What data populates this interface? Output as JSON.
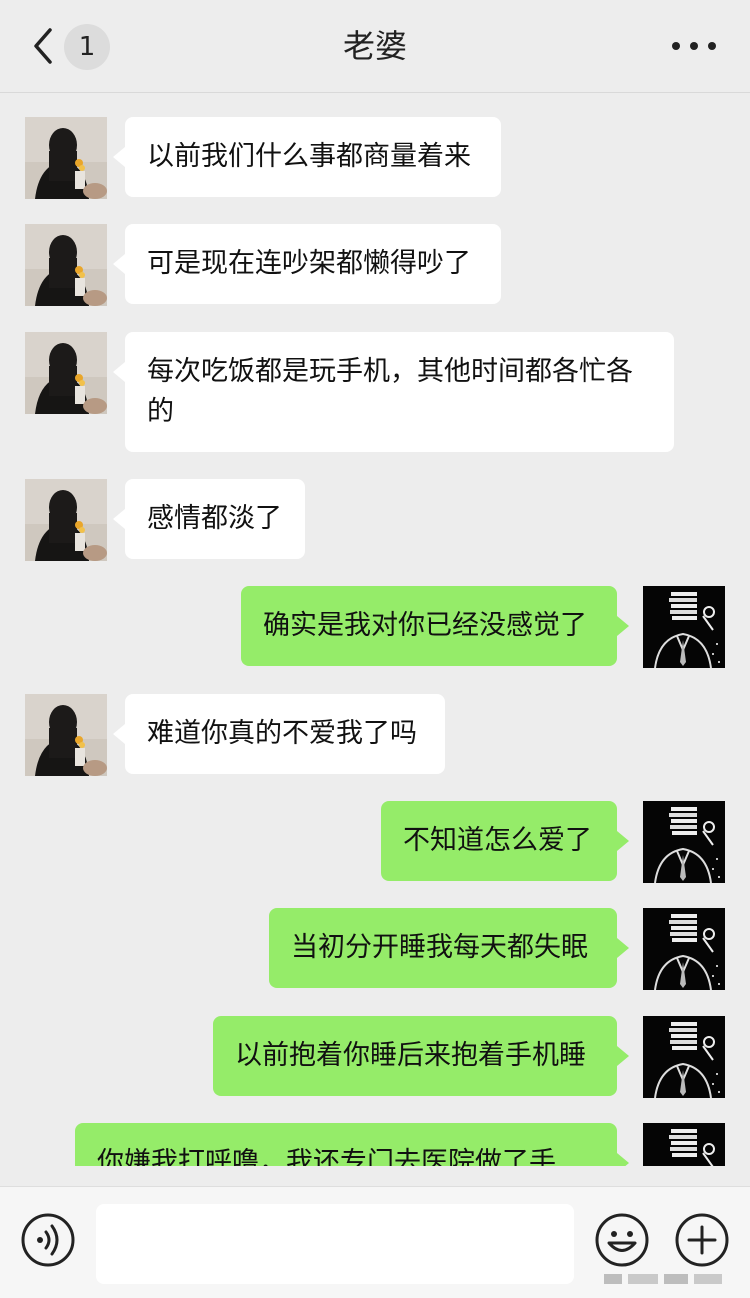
{
  "header": {
    "title": "老婆",
    "unread_count": "1"
  },
  "messages": [
    {
      "side": "in",
      "text": "以前我们什么事都商量着来"
    },
    {
      "side": "in",
      "text": "可是现在连吵架都懒得吵了"
    },
    {
      "side": "in",
      "text": "每次吃饭都是玩手机，其他时间都各忙各的"
    },
    {
      "side": "in",
      "text": "感情都淡了"
    },
    {
      "side": "out",
      "text": "确实是我对你已经没感觉了"
    },
    {
      "side": "in",
      "text": "难道你真的不爱我了吗"
    },
    {
      "side": "out",
      "text": "不知道怎么爱了"
    },
    {
      "side": "out",
      "text": "当初分开睡我每天都失眠"
    },
    {
      "side": "out",
      "text": "以前抱着你睡后来抱着手机睡"
    },
    {
      "side": "out",
      "text": "你嫌我打呼噜，我还专门去医院做了手"
    }
  ],
  "icons": {
    "back": "chevron-left-icon",
    "more": "more-dots-icon",
    "voice": "voice-icon",
    "emoji": "emoji-icon",
    "plus": "plus-icon"
  },
  "colors": {
    "background": "#ededed",
    "incoming_bubble": "#ffffff",
    "outgoing_bubble": "#95ec69"
  }
}
